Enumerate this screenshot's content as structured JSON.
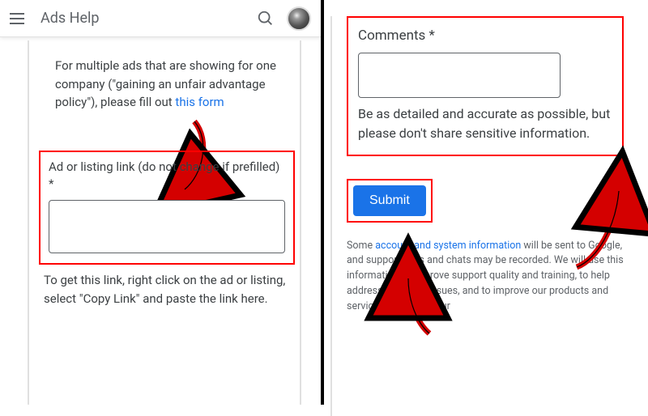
{
  "topbar": {
    "title": "Ads Help"
  },
  "left": {
    "intro_prefix": "For multiple ads that are showing for one company (\"gaining an unfair advantage policy\"), please fill out ",
    "intro_link": "this form",
    "field_label": "Ad or listing link (do not change if prefilled) *",
    "help_text": "To get this link, right click on the ad or listing, select \"Copy Link\" and paste the link here."
  },
  "right": {
    "comments_label": "Comments *",
    "comments_help": "Be as detailed and accurate as possible, but please don't share sensitive information.",
    "submit_label": "Submit",
    "disclaimer_prefix": "Some ",
    "disclaimer_link": "account and system information",
    "disclaimer_suffix": " will be sent to Google, and support calls and chats may be recorded. We will use this information to improve support quality and training, to help address technical issues, and to improve our products and services, subject to our"
  }
}
